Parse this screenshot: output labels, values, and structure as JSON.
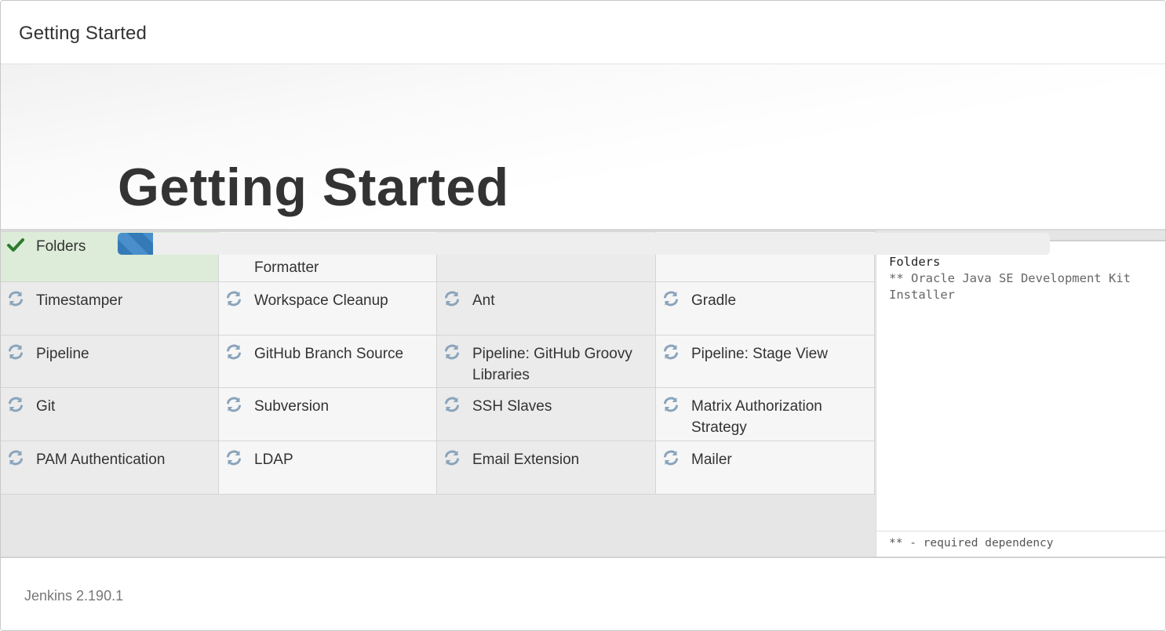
{
  "header": {
    "title": "Getting Started"
  },
  "hero": {
    "title": "Getting Started"
  },
  "progress": {
    "fraction": 0.038
  },
  "plugins": [
    {
      "label": "Folders",
      "status": "done"
    },
    {
      "label": "Formatter",
      "status": "pending"
    },
    {
      "label": "",
      "status": "pending"
    },
    {
      "label": "",
      "status": "pending"
    },
    {
      "label": "Timestamper",
      "status": "pending"
    },
    {
      "label": "Workspace Cleanup",
      "status": "pending"
    },
    {
      "label": "Ant",
      "status": "pending"
    },
    {
      "label": "Gradle",
      "status": "pending"
    },
    {
      "label": "Pipeline",
      "status": "pending"
    },
    {
      "label": "GitHub Branch Source",
      "status": "pending"
    },
    {
      "label": "Pipeline: GitHub Groovy Libraries",
      "status": "pending"
    },
    {
      "label": "Pipeline: Stage View",
      "status": "pending"
    },
    {
      "label": "Git",
      "status": "pending"
    },
    {
      "label": "Subversion",
      "status": "pending"
    },
    {
      "label": "SSH Slaves",
      "status": "pending"
    },
    {
      "label": "Matrix Authorization Strategy",
      "status": "pending"
    },
    {
      "label": "PAM Authentication",
      "status": "pending"
    },
    {
      "label": "LDAP",
      "status": "pending"
    },
    {
      "label": "Email Extension",
      "status": "pending"
    },
    {
      "label": "Mailer",
      "status": "pending"
    }
  ],
  "log": {
    "line1": "Folders",
    "line2": "** Oracle Java SE Development Kit",
    "line3": "Installer"
  },
  "legend": "** - required dependency",
  "footer": {
    "version": "Jenkins 2.190.1"
  },
  "colors": {
    "done_bg": "#dcecd8",
    "done_icon": "#2d7a2d",
    "pending_icon": "#8aa4bb",
    "progress": "#337ab7"
  }
}
